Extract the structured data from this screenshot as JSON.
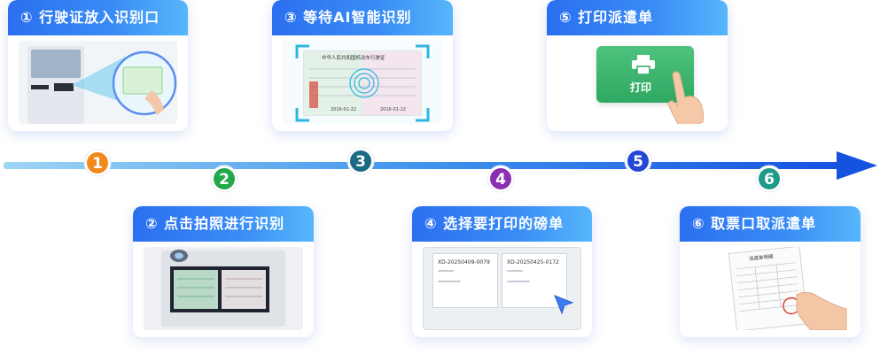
{
  "steps": [
    {
      "num": "1",
      "title": "① 行驶证放入识别口",
      "color": "#f08a1c"
    },
    {
      "num": "2",
      "title": "② 点击拍照进行识别",
      "color": "#23a84a"
    },
    {
      "num": "3",
      "title": "③ 等待AI智能识别",
      "color": "#1b6a86"
    },
    {
      "num": "4",
      "title": "④ 选择要打印的磅单",
      "color": "#8b2fb0"
    },
    {
      "num": "5",
      "title": "⑤ 打印派遣单",
      "color": "#2447d6"
    },
    {
      "num": "6",
      "title": "⑥ 取票口取派遣单",
      "color": "#1e9a8a"
    }
  ],
  "license_card": {
    "title": "中华人民共和国机动车行驶证",
    "date1": "2016-01-22",
    "date2": "2016-01-22"
  },
  "print_button": {
    "label": "打印"
  },
  "tickets": [
    {
      "id": "XD-20250409-0079"
    },
    {
      "id": "XD-20250425-0172"
    }
  ],
  "dispatch_doc": {
    "title": "派遣单明细"
  }
}
